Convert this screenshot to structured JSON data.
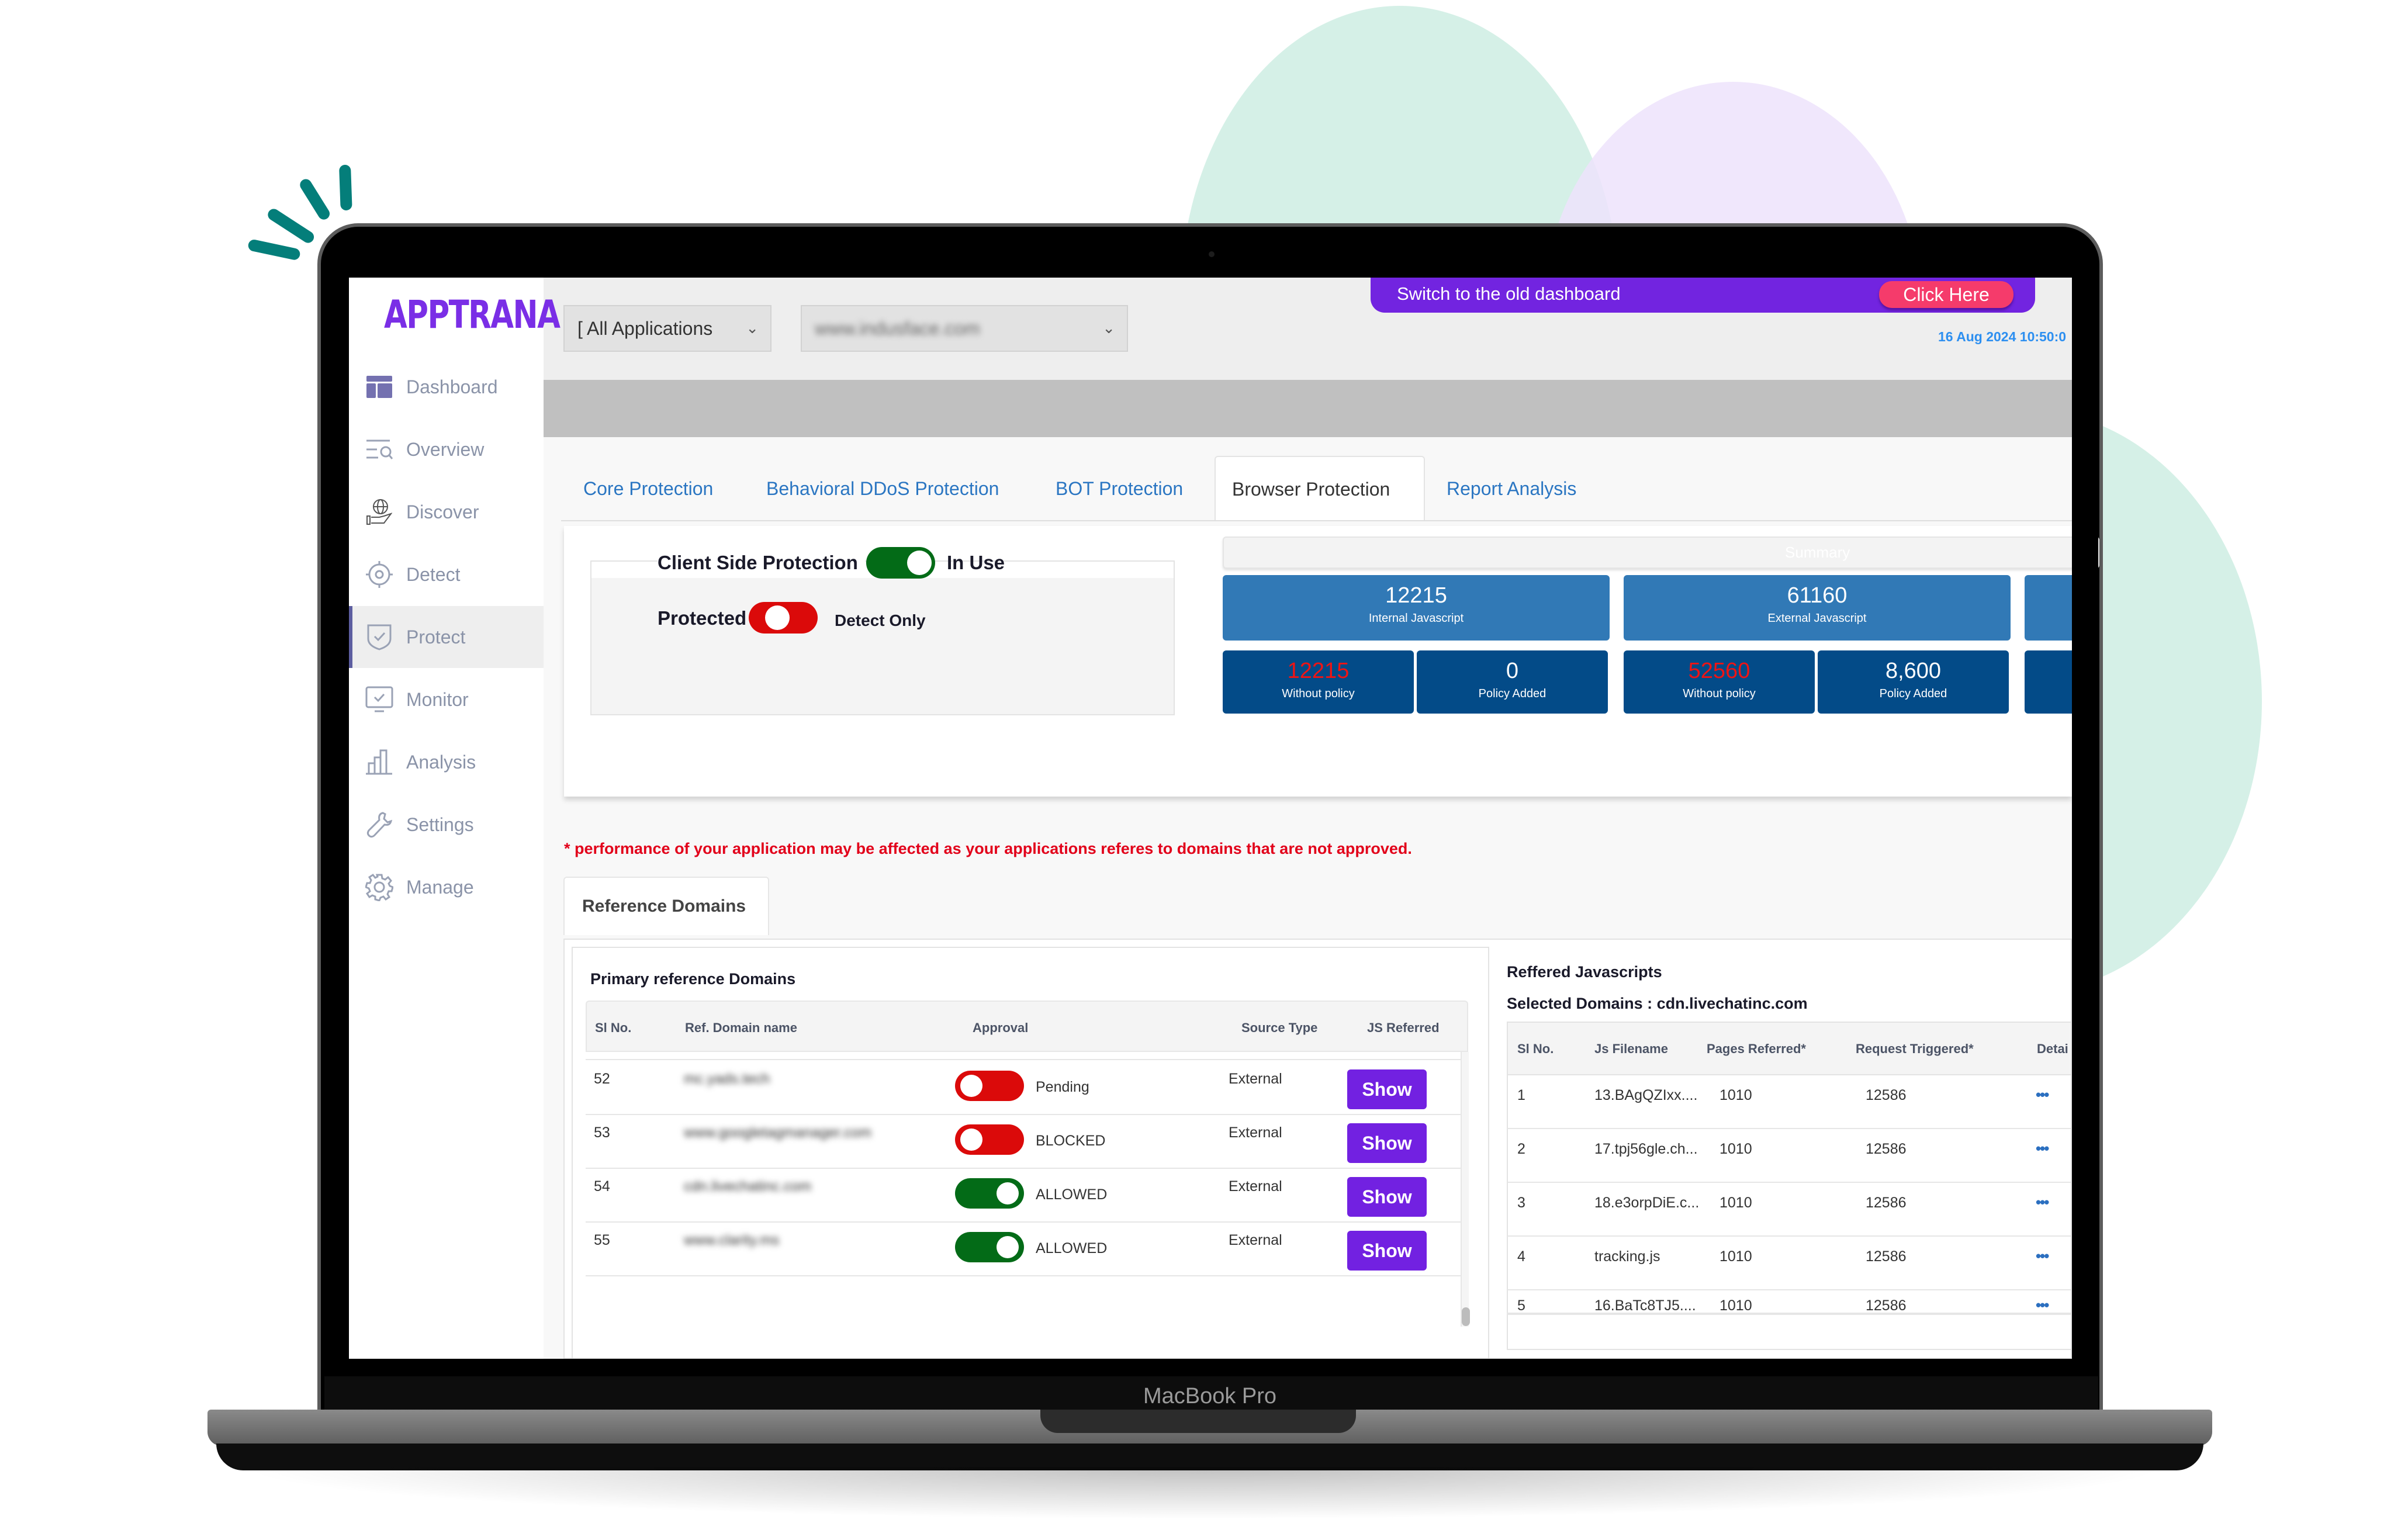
{
  "device": {
    "brand_label": "MacBook Pro"
  },
  "app": {
    "logo": "APPTRANA",
    "header": {
      "app_select": {
        "value": "[ All Applications",
        "chevron": "chevron-down-icon"
      },
      "site_select": {
        "value": "www.indusface.com",
        "chevron": "chevron-down-icon",
        "blurred": true
      },
      "banner": {
        "text": "Switch to the old dashboard",
        "button": "Click Here"
      },
      "timestamp": "16 Aug 2024 10:50:0"
    },
    "sidebar": {
      "items": [
        {
          "label": "Dashboard",
          "icon": "dashboard-icon",
          "active": false
        },
        {
          "label": "Overview",
          "icon": "overview-search-icon",
          "active": false
        },
        {
          "label": "Discover",
          "icon": "globe-hand-icon",
          "active": false
        },
        {
          "label": "Detect",
          "icon": "target-icon",
          "active": false
        },
        {
          "label": "Protect",
          "icon": "shield-check-icon",
          "active": true
        },
        {
          "label": "Monitor",
          "icon": "monitor-check-icon",
          "active": false
        },
        {
          "label": "Analysis",
          "icon": "bar-chart-icon",
          "active": false
        },
        {
          "label": "Settings",
          "icon": "wrench-icon",
          "active": false
        },
        {
          "label": "Manage",
          "icon": "gear-icon",
          "active": false
        }
      ]
    },
    "tabs": [
      {
        "label": "Core Protection",
        "active": false
      },
      {
        "label": "Behavioral DDoS Protection",
        "active": false
      },
      {
        "label": "BOT Protection",
        "active": false
      },
      {
        "label": "Browser Protection",
        "active": true
      },
      {
        "label": "Report Analysis",
        "active": false
      }
    ],
    "client_side": {
      "title": "Client Side Protection",
      "toggle_on": true,
      "status": "In Use",
      "mode_label": "Protected",
      "mode_toggle_on": false,
      "mode_status": "Detect Only"
    },
    "summary": {
      "header": "Summary",
      "groups": [
        {
          "total": "12215",
          "total_label": "Internal Javascript",
          "without_policy": "12215",
          "without_policy_label": "Without policy",
          "policy_added": "0",
          "policy_added_label": "Policy Added"
        },
        {
          "total": "61160",
          "total_label": "External Javascript",
          "without_policy": "52560",
          "without_policy_label": "Without policy",
          "policy_added": "8,600",
          "policy_added_label": "Policy Added"
        }
      ],
      "colors": {
        "total_bg": "#3179b6",
        "sub_bg": "#034b88",
        "alert": "#f01414"
      }
    },
    "warning": "* performance of your application may be affected as your applications referes to domains that are not approved.",
    "reference_tab": "Reference Domains",
    "primary_domains": {
      "title": "Primary reference Domains",
      "columns": [
        "Sl No.",
        "Ref. Domain name",
        "Approval",
        "Source Type",
        "JS Referred"
      ],
      "rows": [
        {
          "sl": "",
          "domain": "",
          "approved": false,
          "status": "",
          "source": "",
          "action": "Show",
          "partial": true
        },
        {
          "sl": "52",
          "domain": "mc.yads.tech",
          "approved": false,
          "status": "Pending",
          "source": "External",
          "action": "Show"
        },
        {
          "sl": "53",
          "domain": "www.googletagmanager.com",
          "approved": false,
          "status": "BLOCKED",
          "source": "External",
          "action": "Show"
        },
        {
          "sl": "54",
          "domain": "cdn.livechatinc.com",
          "approved": true,
          "status": "ALLOWED",
          "source": "External",
          "action": "Show"
        },
        {
          "sl": "55",
          "domain": "www.clarity.ms",
          "approved": true,
          "status": "ALLOWED",
          "source": "External",
          "action": "Show"
        }
      ]
    },
    "referred_js": {
      "title": "Reffered Javascripts",
      "selected": "Selected Domains : cdn.livechatinc.com",
      "columns": [
        "Sl No.",
        "Js Filename",
        "Pages Referred*",
        "Request Triggered*",
        "Detai"
      ],
      "rows": [
        {
          "sl": "1",
          "file": "13.BAgQZIxx....",
          "pages": "1010",
          "requests": "12586",
          "details": "more-icon"
        },
        {
          "sl": "2",
          "file": "17.tpj56gle.ch...",
          "pages": "1010",
          "requests": "12586",
          "details": "more-icon"
        },
        {
          "sl": "3",
          "file": "18.e3orpDiE.c...",
          "pages": "1010",
          "requests": "12586",
          "details": "more-icon"
        },
        {
          "sl": "4",
          "file": "tracking.js",
          "pages": "1010",
          "requests": "12586",
          "details": "more-icon"
        },
        {
          "sl": "5",
          "file": "16.BaTc8TJ5....",
          "pages": "1010",
          "requests": "12586",
          "details": "more-icon"
        }
      ]
    }
  }
}
